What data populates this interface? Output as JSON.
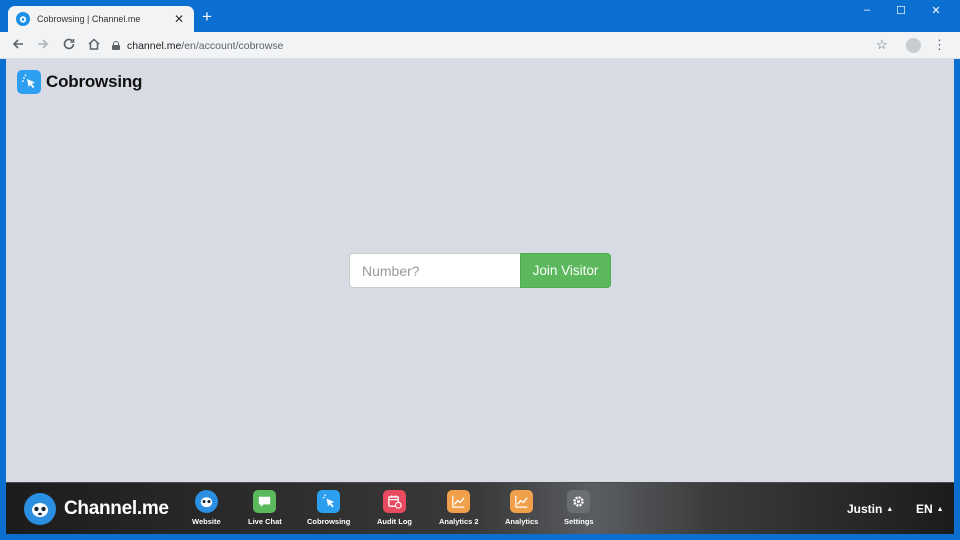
{
  "browser": {
    "tab_title": "Cobrowsing | Channel.me",
    "tab_close": "✕",
    "new_tab": "+",
    "url_host": "channel.me",
    "url_path": "/en/account/cobrowse",
    "window_controls": {
      "minimize": "–",
      "maximize": "☐",
      "close": "✕"
    }
  },
  "page": {
    "title": "Cobrowsing",
    "number_placeholder": "Number?",
    "join_button": "Join Visitor"
  },
  "bottom_bar": {
    "brand": "Channel.me",
    "apps": [
      {
        "label": "Website",
        "icon": "channel-logo-icon",
        "color": "#2a8fe0"
      },
      {
        "label": "Live Chat",
        "icon": "chat-bubble-icon",
        "color": "#5cb85c"
      },
      {
        "label": "Cobrowsing",
        "icon": "cursor-click-icon",
        "color": "#2d9ff0"
      },
      {
        "label": "Audit Log",
        "icon": "calendar-clock-icon",
        "color": "#e84a5f"
      },
      {
        "label": "Analytics 2",
        "icon": "line-chart-icon",
        "color": "#f0a04b"
      },
      {
        "label": "Analytics",
        "icon": "line-chart-icon",
        "color": "#f0a04b"
      },
      {
        "label": "Settings",
        "icon": "gear-icon",
        "color": "#6b6e73"
      }
    ],
    "user": "Justin",
    "language": "EN"
  },
  "colors": {
    "browser_frame": "#0a6fd1",
    "page_background": "#d8dbe3",
    "join_button": "#5cb85c"
  }
}
